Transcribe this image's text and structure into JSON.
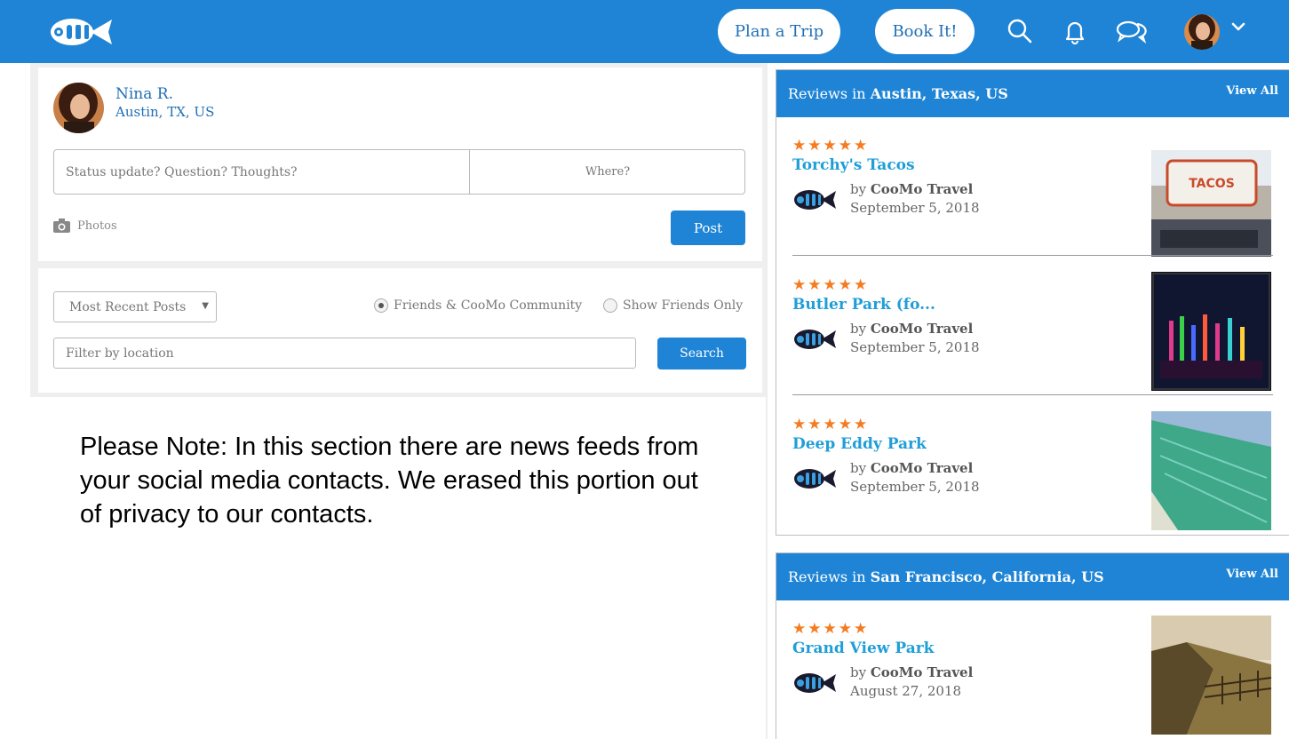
{
  "header": {
    "plan_label": "Plan a Trip",
    "book_label": "Book It!"
  },
  "composer": {
    "user_name": "Nina R.",
    "user_location": "Austin, TX, US",
    "status_placeholder": "Status update? Question? Thoughts?",
    "where_label": " Where?",
    "photos_label": "Photos",
    "post_label": "Post"
  },
  "filters": {
    "sort_selected": "Most Recent Posts",
    "radio_community": "Friends & CooMo Community",
    "radio_friends": "Show Friends Only",
    "location_placeholder": "Filter by location",
    "search_label": "Search"
  },
  "note": "Please Note: In this section there are news feeds from your social media contacts. We erased this portion out of privacy to our contacts.",
  "reviews_austin": {
    "title_prefix": "Reviews in ",
    "location": "Austin, Texas, US",
    "view_all": "View All",
    "items": [
      {
        "stars": "★★★★★",
        "place": "Torchy's Tacos",
        "by": "by ",
        "author": "CooMo Travel",
        "date": "September 5, 2018"
      },
      {
        "stars": "★★★★★",
        "place": "Butler Park (fo...",
        "by": "by ",
        "author": "CooMo Travel",
        "date": "September 5, 2018"
      },
      {
        "stars": "★★★★★",
        "place": "Deep Eddy Park",
        "by": "by ",
        "author": "CooMo Travel",
        "date": "September 5, 2018"
      }
    ]
  },
  "reviews_sf": {
    "title_prefix": "Reviews in ",
    "location": "San Francisco, California, US",
    "view_all": "View All",
    "items": [
      {
        "stars": "★★★★★",
        "place": "Grand View Park",
        "by": "by ",
        "author": "CooMo Travel",
        "date": "August 27, 2018"
      }
    ]
  },
  "colors": {
    "brand_blue": "#1f84d5",
    "link_blue": "#1f9ed8",
    "star_orange": "#f47b20"
  },
  "icons": [
    "coomo-logo",
    "search-icon",
    "bell-icon",
    "chat-icon",
    "chevron-down-icon",
    "camera-icon",
    "map-marker-icon"
  ]
}
